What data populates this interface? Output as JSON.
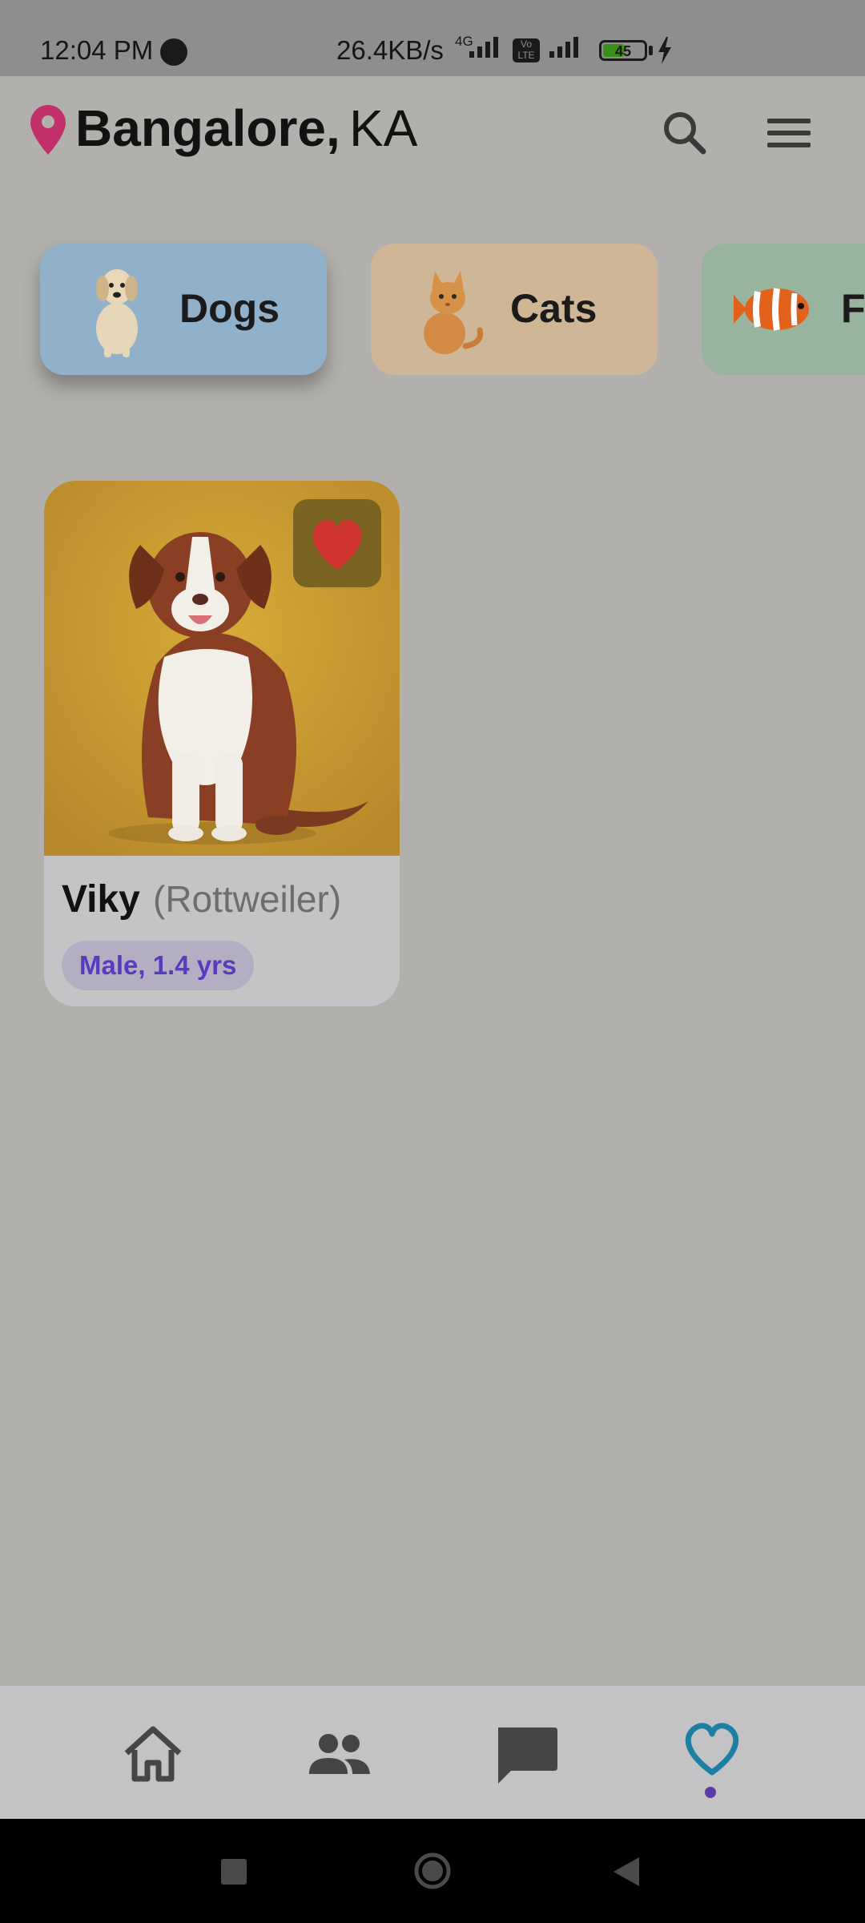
{
  "status_bar": {
    "time": "12:04 PM",
    "net_speed": "26.4KB/s",
    "network_type": "4G",
    "volte": "Vo LTE",
    "battery": "45"
  },
  "header": {
    "city": "Bangalore,",
    "state": "KA",
    "icons": [
      "location-pin-icon",
      "search-icon",
      "menu-icon"
    ]
  },
  "categories": [
    {
      "label": "Dogs",
      "color": "#91b1cb",
      "selected": true
    },
    {
      "label": "Cats",
      "color": "#cfb696",
      "selected": false
    },
    {
      "label": "Fi",
      "color": "#98b39e",
      "selected": false
    }
  ],
  "pets": [
    {
      "name": "Viky",
      "breed": "(Rottweiler)",
      "tag": "Male, 1.4 yrs",
      "favorite": true
    }
  ],
  "bottom_nav": {
    "items": [
      "home-icon",
      "people-icon",
      "chat-icon",
      "favorites-icon"
    ],
    "active": "favorites"
  },
  "colors": {
    "accent_pin": "#c2306c",
    "accent_heart": "#cf3430",
    "active_nav": "#1d7fa3",
    "tag_text": "#5a3bbf"
  }
}
